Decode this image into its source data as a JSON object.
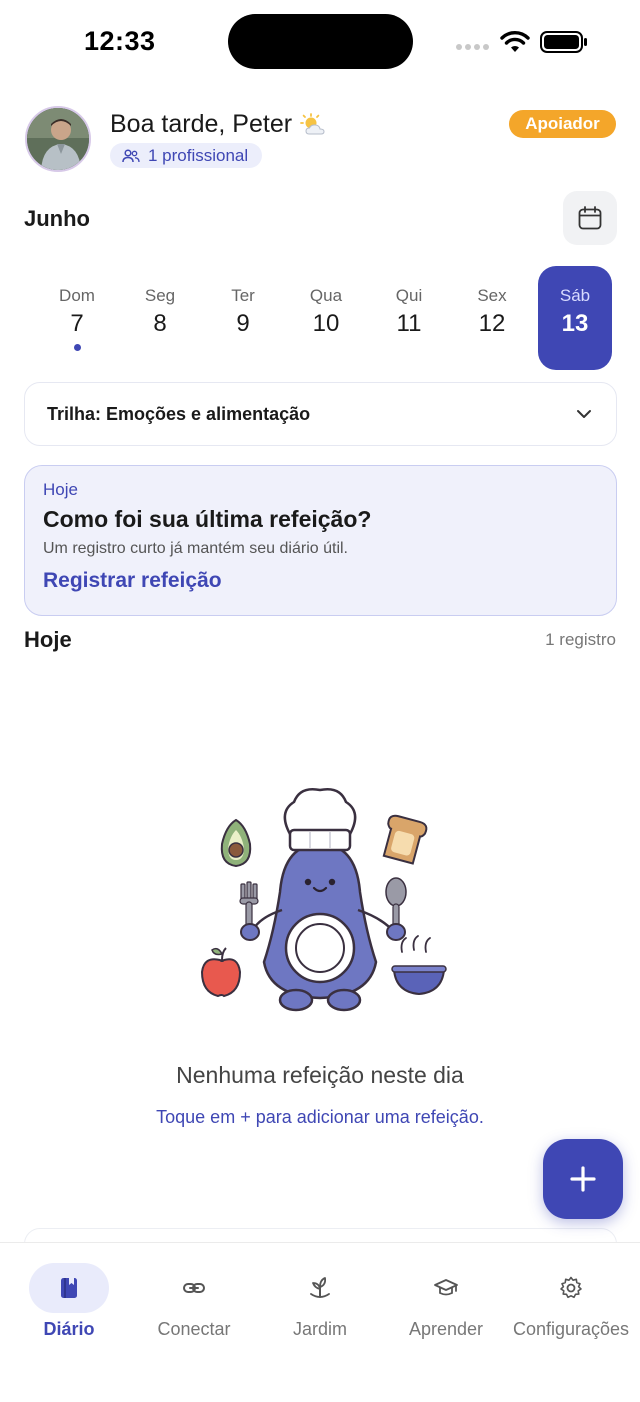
{
  "status_bar": {
    "time": "12:33"
  },
  "header": {
    "greeting": "Boa tarde, Peter",
    "professional_chip": "1 profissional",
    "badge": "Apoiador"
  },
  "calendar": {
    "month": "Junho",
    "days": [
      {
        "name": "Dom",
        "num": "7",
        "has_entry": true,
        "selected": false
      },
      {
        "name": "Seg",
        "num": "8",
        "has_entry": false,
        "selected": false
      },
      {
        "name": "Ter",
        "num": "9",
        "has_entry": false,
        "selected": false
      },
      {
        "name": "Qua",
        "num": "10",
        "has_entry": false,
        "selected": false
      },
      {
        "name": "Qui",
        "num": "11",
        "has_entry": false,
        "selected": false
      },
      {
        "name": "Sex",
        "num": "12",
        "has_entry": false,
        "selected": false
      },
      {
        "name": "Sáb",
        "num": "13",
        "has_entry": false,
        "selected": true
      }
    ]
  },
  "track": {
    "label": "Trilha: Emoções e alimentação"
  },
  "today_card": {
    "eyebrow": "Hoje",
    "title": "Como foi sua última refeição?",
    "subtitle": "Um registro curto já mantém seu diário útil.",
    "link": "Registrar refeição"
  },
  "section": {
    "title": "Hoje",
    "count": "1 registro"
  },
  "empty_state": {
    "title": "Nenhuma refeição neste dia",
    "subtitle": "Toque em + para adicionar uma refeição."
  },
  "tabs": [
    {
      "label": "Diário",
      "icon": "book-icon",
      "active": true
    },
    {
      "label": "Conectar",
      "icon": "link-icon",
      "active": false
    },
    {
      "label": "Jardim",
      "icon": "sprout-icon",
      "active": false
    },
    {
      "label": "Aprender",
      "icon": "graduation-cap-icon",
      "active": false
    },
    {
      "label": "Configurações",
      "icon": "gear-icon",
      "active": false
    }
  ],
  "colors": {
    "primary": "#3f47b4",
    "badge": "#f4a62a",
    "card_bg": "#f0f1fb"
  }
}
